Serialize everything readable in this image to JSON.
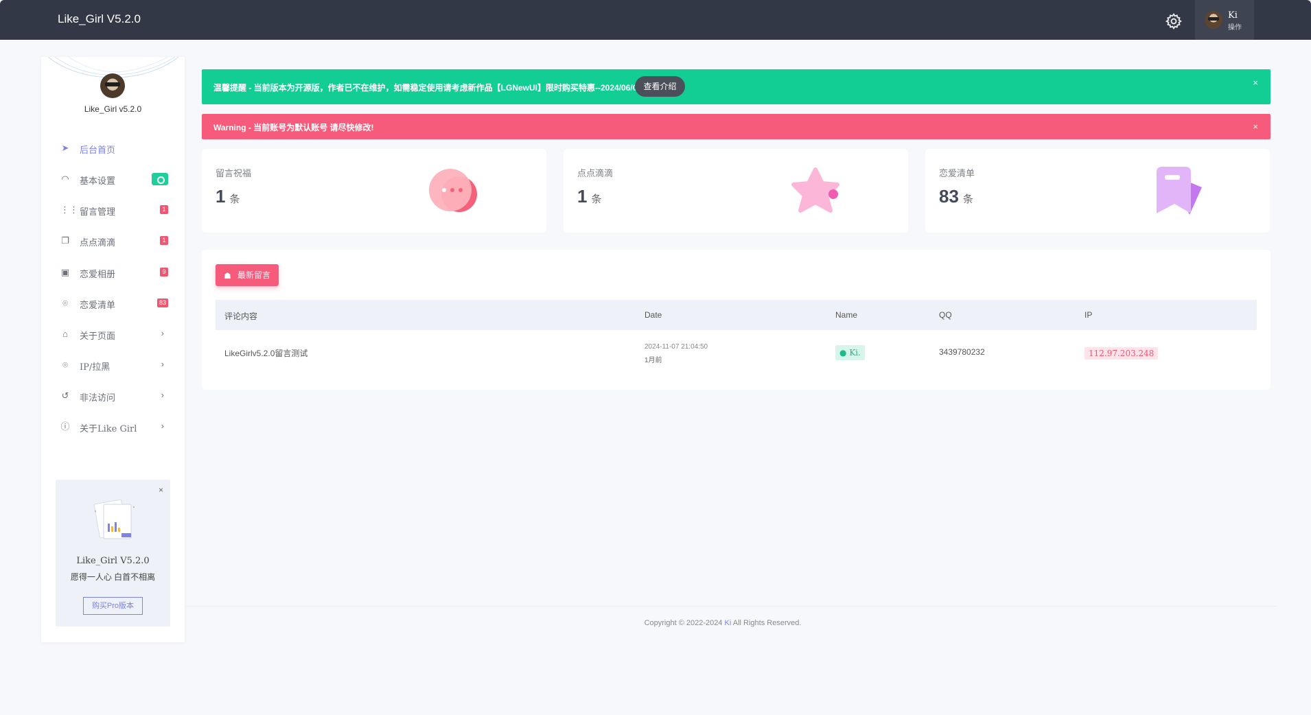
{
  "header": {
    "brand": "Like_Girl V5.2.0",
    "user_name": "Ki",
    "user_role": "操作"
  },
  "sidebar": {
    "title": "Like_Girl v5.2.0",
    "items": [
      {
        "label": "后台首页",
        "icon": "send-icon",
        "badge": "",
        "chevron": ""
      },
      {
        "label": "基本设置",
        "icon": "speedometer-icon",
        "badge": "",
        "chevron": ""
      },
      {
        "label": "留言管理",
        "icon": "grid-icon",
        "badge": "1",
        "chevron": ""
      },
      {
        "label": "点点滴滴",
        "icon": "copy-icon",
        "badge": "1",
        "chevron": ""
      },
      {
        "label": "恋爱相册",
        "icon": "camera-icon",
        "badge": "9",
        "chevron": ""
      },
      {
        "label": "恋爱清单",
        "icon": "map-pin-icon",
        "badge": "83",
        "chevron": ""
      },
      {
        "label": "关于页面",
        "icon": "tag-icon",
        "badge": "",
        "chevron": "›"
      },
      {
        "label": "IP/拉黑",
        "icon": "location-icon",
        "badge": "",
        "chevron": "›"
      },
      {
        "label": "非法访问",
        "icon": "history-icon",
        "badge": "",
        "chevron": "›"
      },
      {
        "label": "关于Like Girl",
        "icon": "info-icon",
        "badge": "",
        "chevron": "›"
      }
    ],
    "promo": {
      "title": "Like_Girl V5.2.0",
      "subtitle": "愿得一人心 白首不相离",
      "button": "购买Pro版本",
      "close": "×"
    }
  },
  "alerts": {
    "green": {
      "text": "温馨提醒 - 当前版本为开源版，作者已不在维护，如需稳定使用请考虑新作品【LGNewUI】限时购买特惠--2024/06/09",
      "button": "查看介绍",
      "close": "×"
    },
    "red": {
      "text": "Warning - 当前账号为默认账号 请尽快修改!",
      "close": "×"
    }
  },
  "cards": [
    {
      "label": "留言祝福",
      "count": "1",
      "unit": "条"
    },
    {
      "label": "点点滴滴",
      "count": "1",
      "unit": "条"
    },
    {
      "label": "恋爱清单",
      "count": "83",
      "unit": "条"
    }
  ],
  "messages": {
    "button": "最新留言",
    "columns": [
      "评论内容",
      "Date",
      "Name",
      "QQ",
      "IP"
    ],
    "rows": [
      {
        "content": "LikeGirlv5.2.0留言测试",
        "date": "2024-11-07 21:04:50",
        "relative": "1月前",
        "name": "Ki.",
        "qq": "3439780232",
        "ip": "112.97.203.248"
      }
    ]
  },
  "footer": {
    "prefix": "Copyright © 2022-2024",
    "author": "Ki",
    "suffix": "All Rights Reserved."
  },
  "colors": {
    "accent": "#7c83e5",
    "success": "#12cd94",
    "danger": "#f65b7b",
    "topbar": "#333846"
  }
}
